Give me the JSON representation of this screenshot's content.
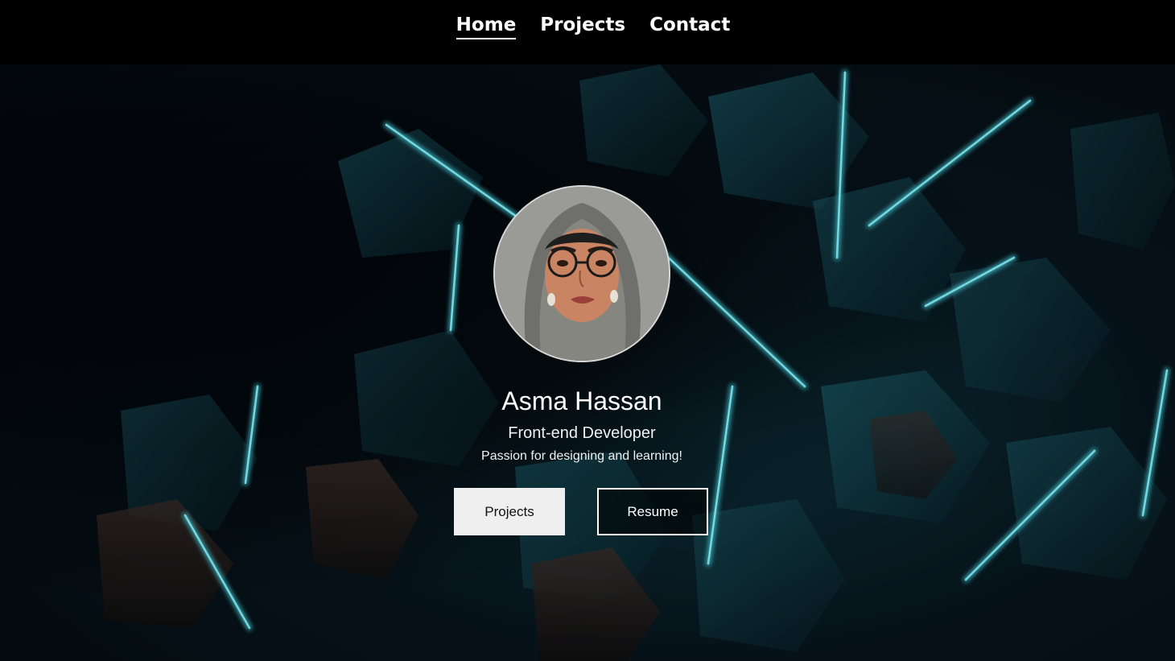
{
  "nav": {
    "items": [
      {
        "label": "Home",
        "active": true
      },
      {
        "label": "Projects",
        "active": false
      },
      {
        "label": "Contact",
        "active": false
      }
    ]
  },
  "hero": {
    "name": "Asma Hassan",
    "role": "Front-end Developer",
    "tagline": "Passion for designing and learning!",
    "buttons": {
      "projects_label": "Projects",
      "resume_label": "Resume"
    }
  },
  "colors": {
    "nav_background": "#000000",
    "accent_teal": "#3fb3bf",
    "button_light": "#efefef"
  }
}
